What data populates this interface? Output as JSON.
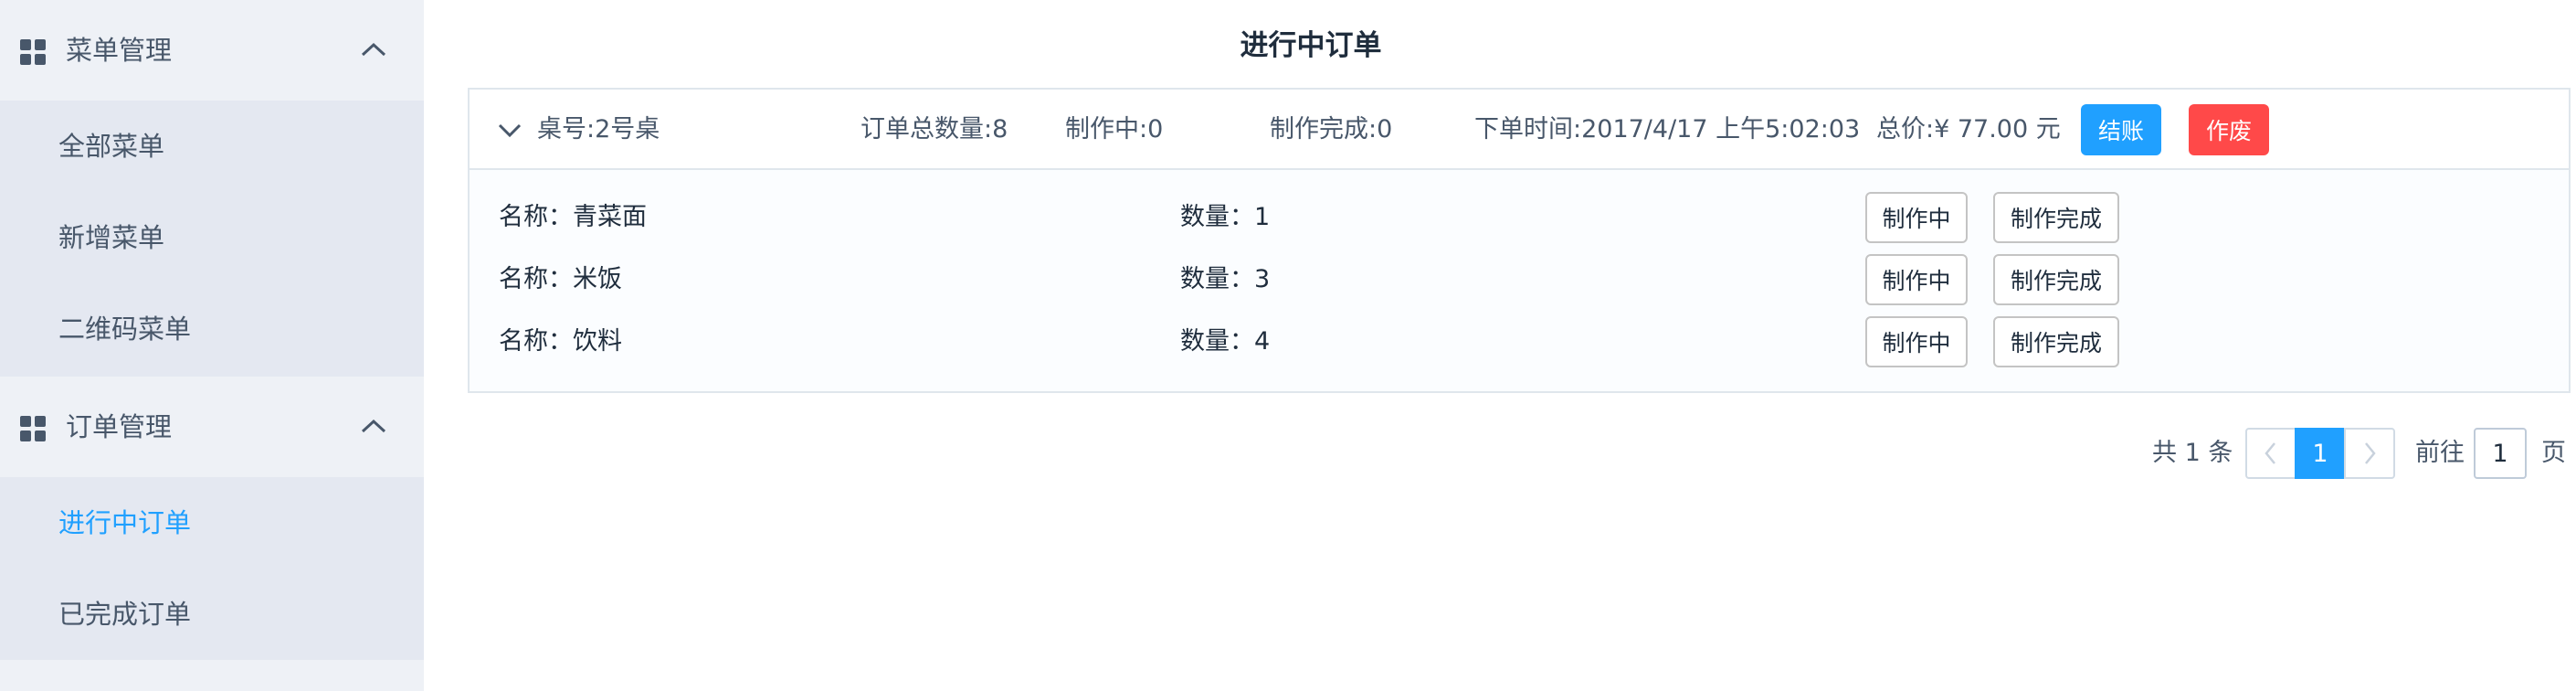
{
  "sidebar": {
    "groups": [
      {
        "title": "菜单管理",
        "items": [
          {
            "label": "全部菜单"
          },
          {
            "label": "新增菜单"
          },
          {
            "label": "二维码菜单"
          }
        ]
      },
      {
        "title": "订单管理",
        "items": [
          {
            "label": "进行中订单",
            "active": true
          },
          {
            "label": "已完成订单"
          }
        ]
      }
    ]
  },
  "page": {
    "title": "进行中订单"
  },
  "order": {
    "table": "桌号:2号桌",
    "total_qty": "订单总数量:8",
    "in_progress": "制作中:0",
    "completed": "制作完成:0",
    "order_time": "下单时间:2017/4/17 上午5:02:03",
    "total_price": "总价:¥ 77.00 元",
    "pay_label": "结账",
    "void_label": "作废",
    "items": [
      {
        "name": "名称：青菜面",
        "qty": "数量：1",
        "cooking_label": "制作中",
        "done_label": "制作完成"
      },
      {
        "name": "名称：米饭",
        "qty": "数量：3",
        "cooking_label": "制作中",
        "done_label": "制作完成"
      },
      {
        "name": "名称：饮料",
        "qty": "数量：4",
        "cooking_label": "制作中",
        "done_label": "制作完成"
      }
    ]
  },
  "pagination": {
    "total": "共 1 条",
    "current_page": "1",
    "goto_label": "前往",
    "goto_value": "1",
    "page_suffix": "页"
  },
  "colors": {
    "accent": "#20a0ff",
    "danger": "#ff4949",
    "sidebar_bg": "#eef1f6",
    "submenu_bg": "#e4e8f1"
  }
}
